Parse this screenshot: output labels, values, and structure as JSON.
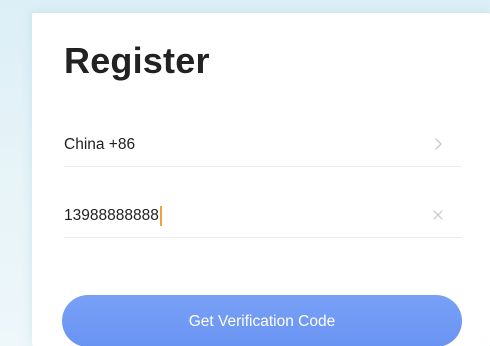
{
  "page": {
    "title": "Register"
  },
  "country_selector": {
    "value": "China +86",
    "icon": "chevron-right-icon"
  },
  "phone_field": {
    "value": "13988888888",
    "icon": "clear-icon"
  },
  "actions": {
    "verification_button_label": "Get Verification Code"
  },
  "colors": {
    "accent": "#6f98f4",
    "caret": "#f2a13c",
    "background": "#e3f2f7"
  }
}
